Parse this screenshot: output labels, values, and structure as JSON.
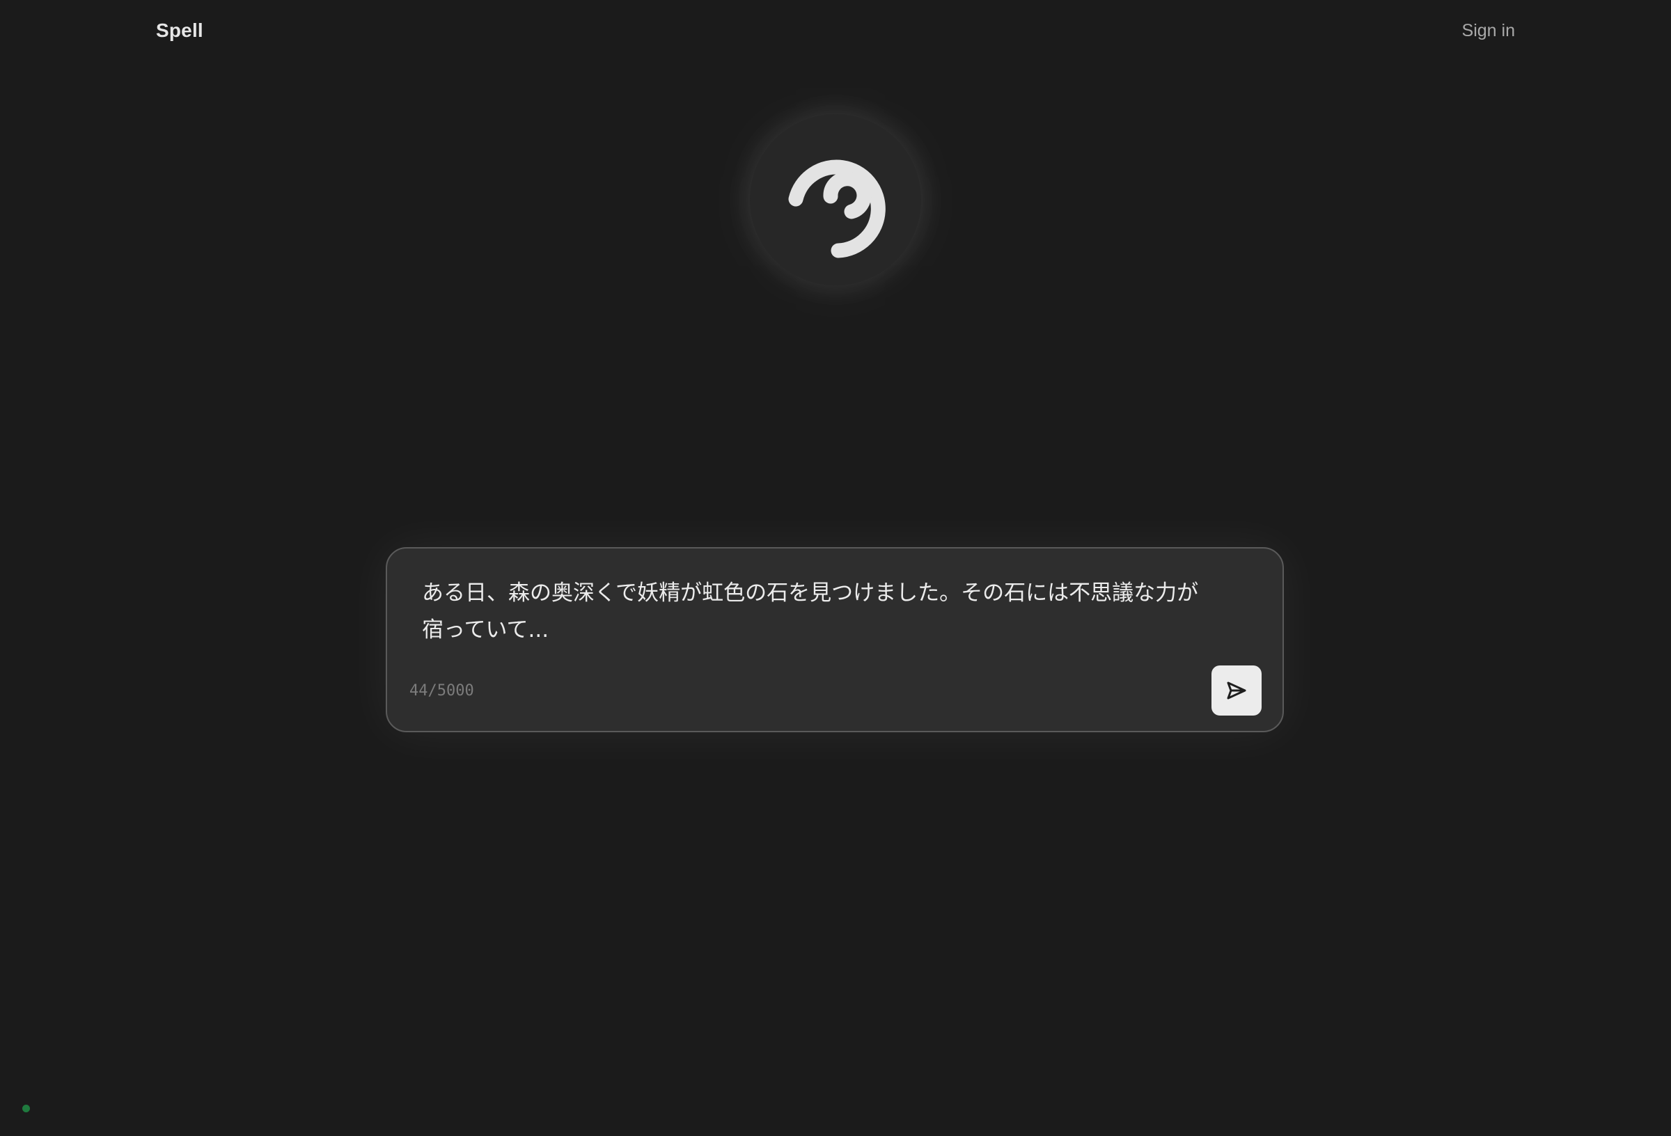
{
  "header": {
    "brand": "Spell",
    "sign_in_label": "Sign in"
  },
  "logo": {
    "icon": "spiral-swirl-icon"
  },
  "composer": {
    "text": "ある日、森の奥深くで妖精が虹色の石を見つけました。その石には不思議な力が宿っていて...",
    "char_count": "44/5000",
    "send_icon": "send-arrow-icon"
  },
  "status": {
    "indicator_color": "#1f7a3e"
  },
  "colors": {
    "background": "#1b1b1b",
    "panel": "#2e2e2e",
    "accent": "#ececec"
  }
}
